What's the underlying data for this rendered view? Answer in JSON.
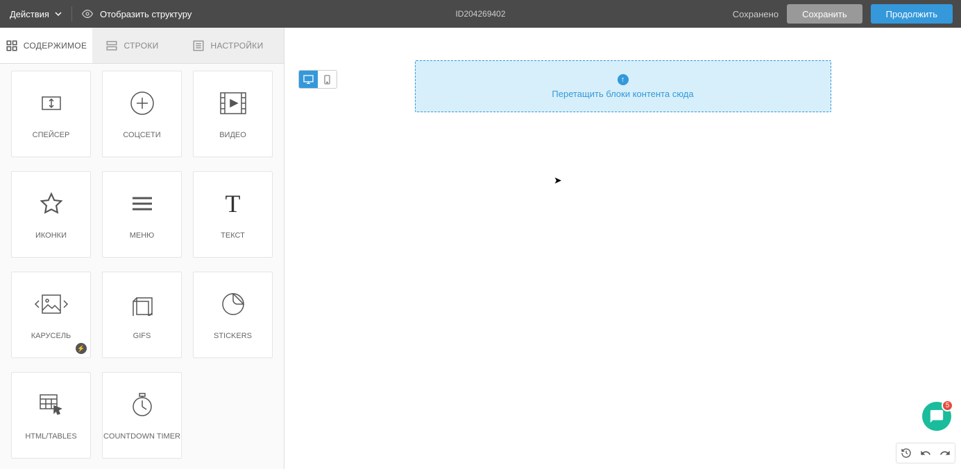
{
  "topbar": {
    "actions": "Действия",
    "show_structure": "Отобразить структуру",
    "doc_id": "ID204269402",
    "saved": "Сохранено",
    "save_btn": "Сохранить",
    "continue_btn": "Продолжить"
  },
  "tabs": {
    "content": "СОДЕРЖИМОЕ",
    "rows": "СТРОКИ",
    "settings": "НАСТРОЙКИ"
  },
  "blocks": [
    {
      "label": "СПЕЙСЕР",
      "icon": "spacer"
    },
    {
      "label": "СОЦСЕТИ",
      "icon": "social"
    },
    {
      "label": "ВИДЕО",
      "icon": "video"
    },
    {
      "label": "ИКОНКИ",
      "icon": "star"
    },
    {
      "label": "МЕНЮ",
      "icon": "menu"
    },
    {
      "label": "ТЕКСТ",
      "icon": "text"
    },
    {
      "label": "КАРУСЕЛЬ",
      "icon": "carousel",
      "badge": true
    },
    {
      "label": "GIFS",
      "icon": "gifs"
    },
    {
      "label": "STICKERS",
      "icon": "stickers"
    },
    {
      "label": "HTML/TABLES",
      "icon": "html"
    },
    {
      "label": "COUNTDOWN TIMER",
      "icon": "timer"
    }
  ],
  "dropzone": {
    "text": "Перетащить блоки контента сюда"
  },
  "chat": {
    "badge": "5"
  }
}
